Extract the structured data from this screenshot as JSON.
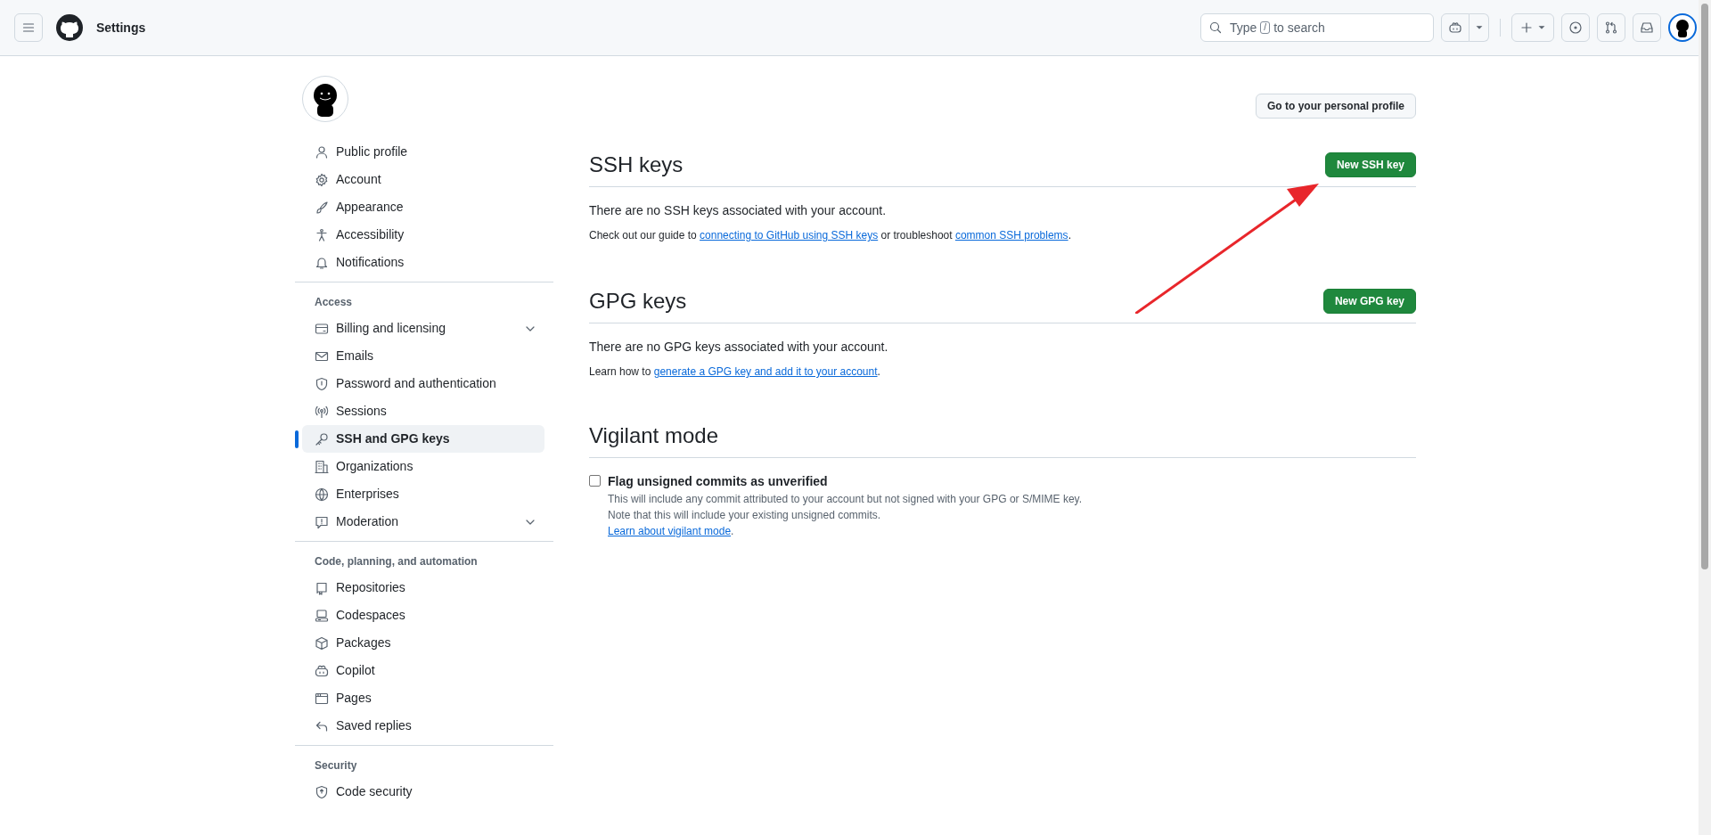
{
  "header": {
    "title": "Settings",
    "search": {
      "before": "Type",
      "key": "/",
      "after": "to search"
    }
  },
  "profile_button": "Go to your personal profile",
  "sidebar": [
    {
      "items": [
        {
          "label": "Public profile",
          "selected": false,
          "expandable": false
        },
        {
          "label": "Account",
          "selected": false,
          "expandable": false
        },
        {
          "label": "Appearance",
          "selected": false,
          "expandable": false
        },
        {
          "label": "Accessibility",
          "selected": false,
          "expandable": false
        },
        {
          "label": "Notifications",
          "selected": false,
          "expandable": false
        }
      ]
    },
    {
      "heading": "Access",
      "items": [
        {
          "label": "Billing and licensing",
          "selected": false,
          "expandable": true
        },
        {
          "label": "Emails",
          "selected": false,
          "expandable": false
        },
        {
          "label": "Password and authentication",
          "selected": false,
          "expandable": false
        },
        {
          "label": "Sessions",
          "selected": false,
          "expandable": false
        },
        {
          "label": "SSH and GPG keys",
          "selected": true,
          "expandable": false
        },
        {
          "label": "Organizations",
          "selected": false,
          "expandable": false
        },
        {
          "label": "Enterprises",
          "selected": false,
          "expandable": false
        },
        {
          "label": "Moderation",
          "selected": false,
          "expandable": true
        }
      ]
    },
    {
      "heading": "Code, planning, and automation",
      "items": [
        {
          "label": "Repositories",
          "selected": false,
          "expandable": false
        },
        {
          "label": "Codespaces",
          "selected": false,
          "expandable": false
        },
        {
          "label": "Packages",
          "selected": false,
          "expandable": false
        },
        {
          "label": "Copilot",
          "selected": false,
          "expandable": false
        },
        {
          "label": "Pages",
          "selected": false,
          "expandable": false
        },
        {
          "label": "Saved replies",
          "selected": false,
          "expandable": false
        }
      ]
    },
    {
      "heading": "Security",
      "items": [
        {
          "label": "Code security",
          "selected": false,
          "expandable": false
        }
      ]
    }
  ],
  "sections": [
    {
      "title": "SSH keys",
      "button": "New SSH key",
      "empty": "There are no SSH keys associated with your account.",
      "help": [
        {
          "kind": "text",
          "text": "Check out our guide to "
        },
        {
          "kind": "link",
          "text": "connecting to GitHub using SSH keys"
        },
        {
          "kind": "text",
          "text": " or troubleshoot "
        },
        {
          "kind": "link",
          "text": "common SSH problems"
        },
        {
          "kind": "text",
          "text": "."
        }
      ]
    },
    {
      "title": "GPG keys",
      "button": "New GPG key",
      "empty": "There are no GPG keys associated with your account.",
      "help": [
        {
          "kind": "text",
          "text": "Learn how to "
        },
        {
          "kind": "link",
          "text": "generate a GPG key and add it to your account"
        },
        {
          "kind": "text",
          "text": "."
        }
      ]
    }
  ],
  "vigilant": {
    "title": "Vigilant mode",
    "checkbox": {
      "label": "Flag unsigned commits as unverified",
      "checked": false
    },
    "description": [
      "This will include any commit attributed to your account but not signed with your GPG or S/MIME key.",
      "Note that this will include your existing unsigned commits."
    ],
    "link": "Learn about vigilant mode",
    "link_suffix": "."
  }
}
